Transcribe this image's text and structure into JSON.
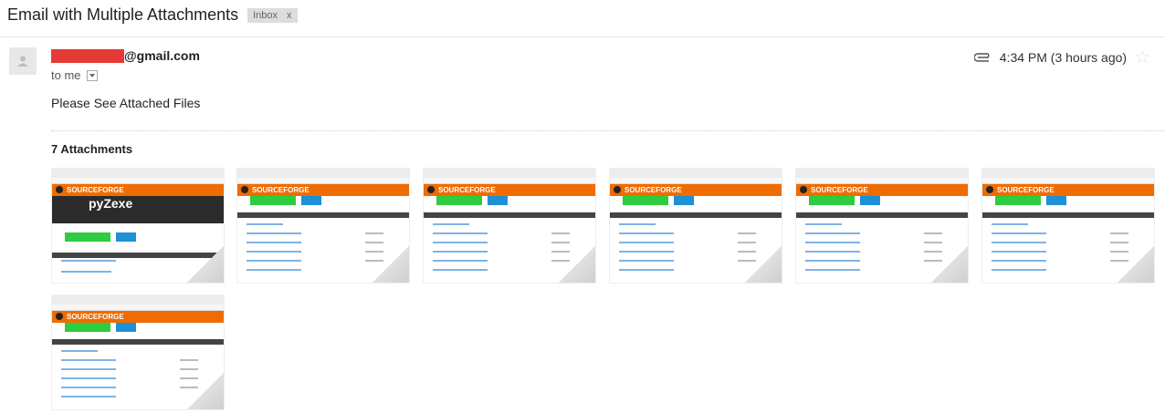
{
  "email": {
    "subject": "Email with Multiple Attachments",
    "label": "Inbox",
    "label_close": "x",
    "sender_domain": "@gmail.com",
    "to_line": "to me",
    "time": "4:34 PM (3 hours ago)",
    "body": "Please See Attached Files",
    "attachments_title": "7 Attachments"
  },
  "colors": {
    "redaction": "#e53935",
    "sourceforge_orange": "#ef6c00"
  },
  "icons": {
    "avatar": "person-icon",
    "attachment": "paperclip-icon",
    "star": "star-icon",
    "dropdown": "chevron-down-icon"
  },
  "attachments": [
    {
      "thumb_title": "SOURCEFORGE",
      "thumb_heading": "pyZexe"
    },
    {
      "thumb_title": "SOURCEFORGE"
    },
    {
      "thumb_title": "SOURCEFORGE"
    },
    {
      "thumb_title": "SOURCEFORGE"
    },
    {
      "thumb_title": "SOURCEFORGE"
    },
    {
      "thumb_title": "SOURCEFORGE"
    },
    {
      "thumb_title": "SOURCEFORGE"
    }
  ]
}
